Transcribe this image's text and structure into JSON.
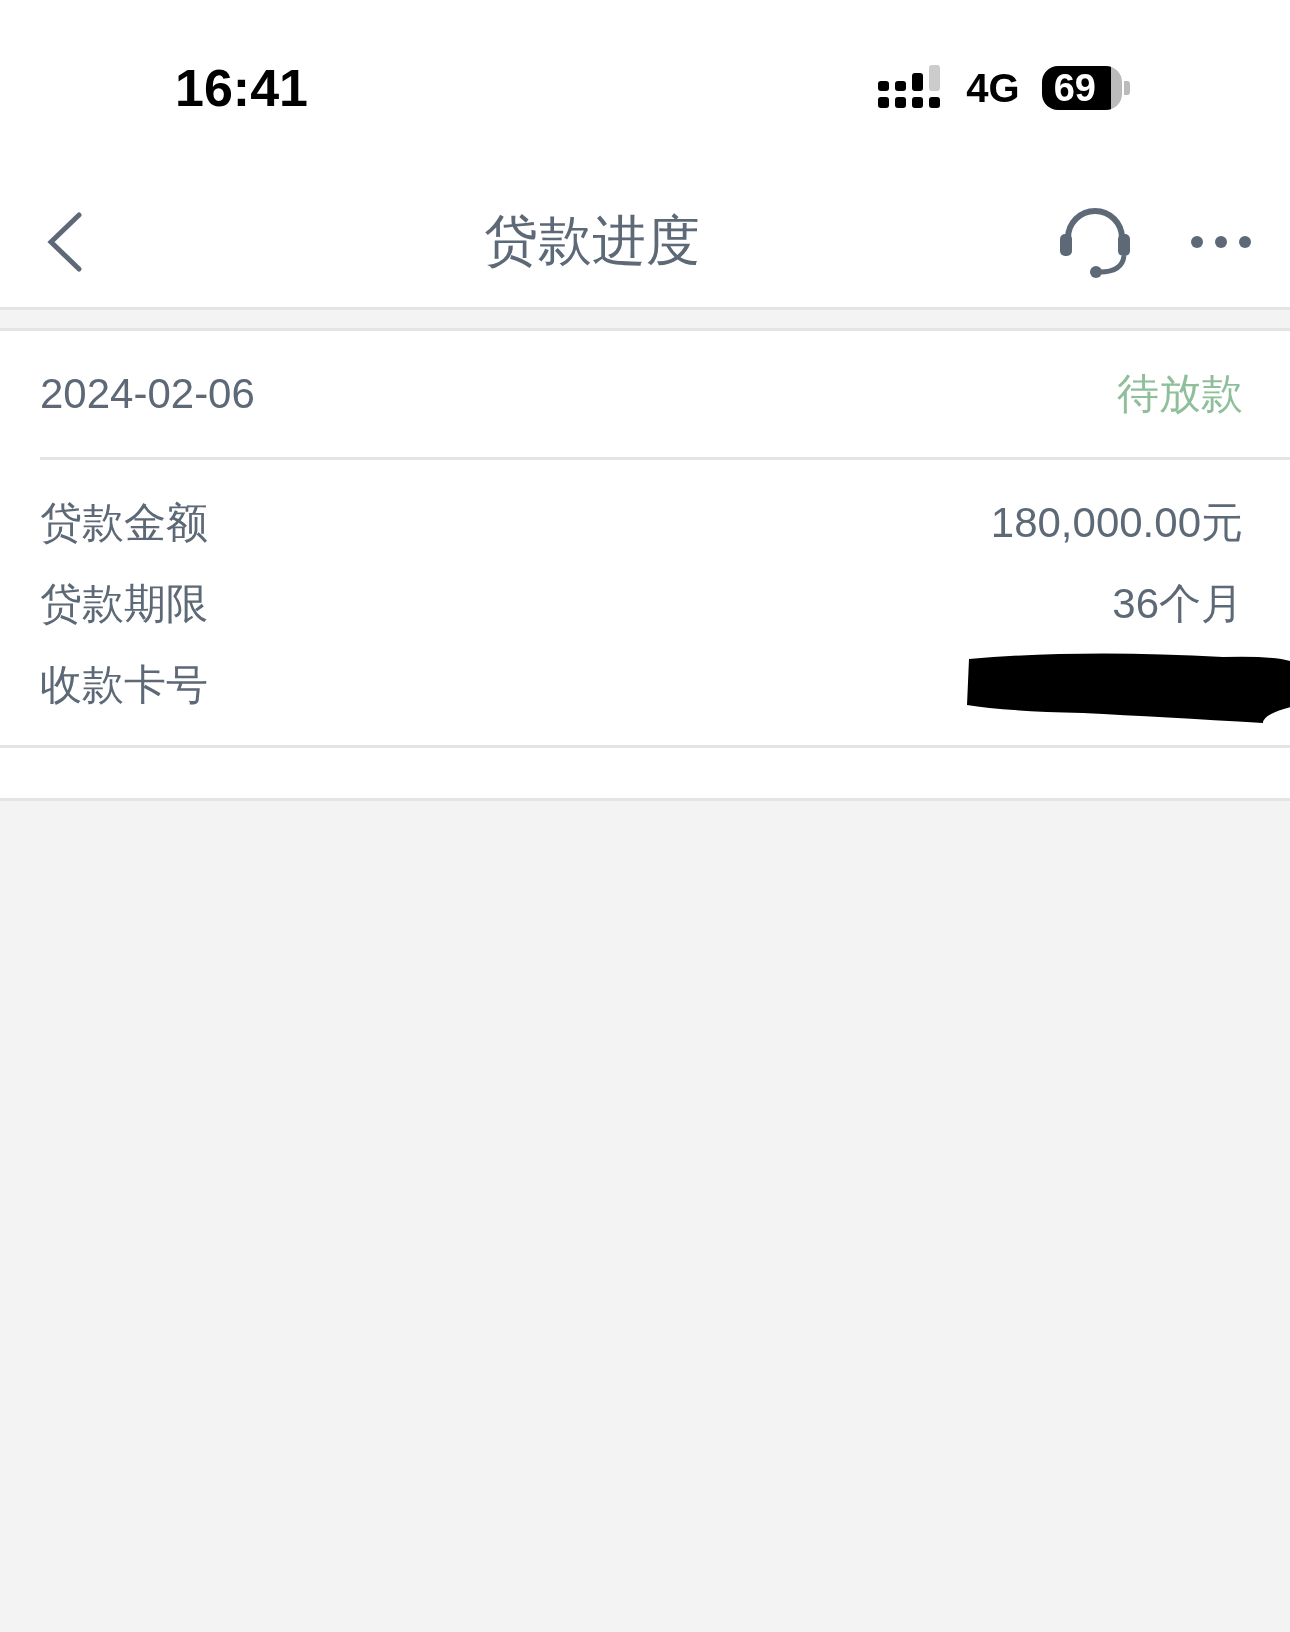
{
  "status_bar": {
    "time": "16:41",
    "network": "4G",
    "battery": "69"
  },
  "header": {
    "title": "贷款进度"
  },
  "loan": {
    "date": "2024-02-06",
    "status": "待放款",
    "rows": [
      {
        "label": "贷款金额",
        "value": "180,000.00元",
        "kind": "text"
      },
      {
        "label": "贷款期限",
        "value": "36个月",
        "kind": "text"
      },
      {
        "label": "收款卡号",
        "kind": "redacted"
      }
    ]
  }
}
